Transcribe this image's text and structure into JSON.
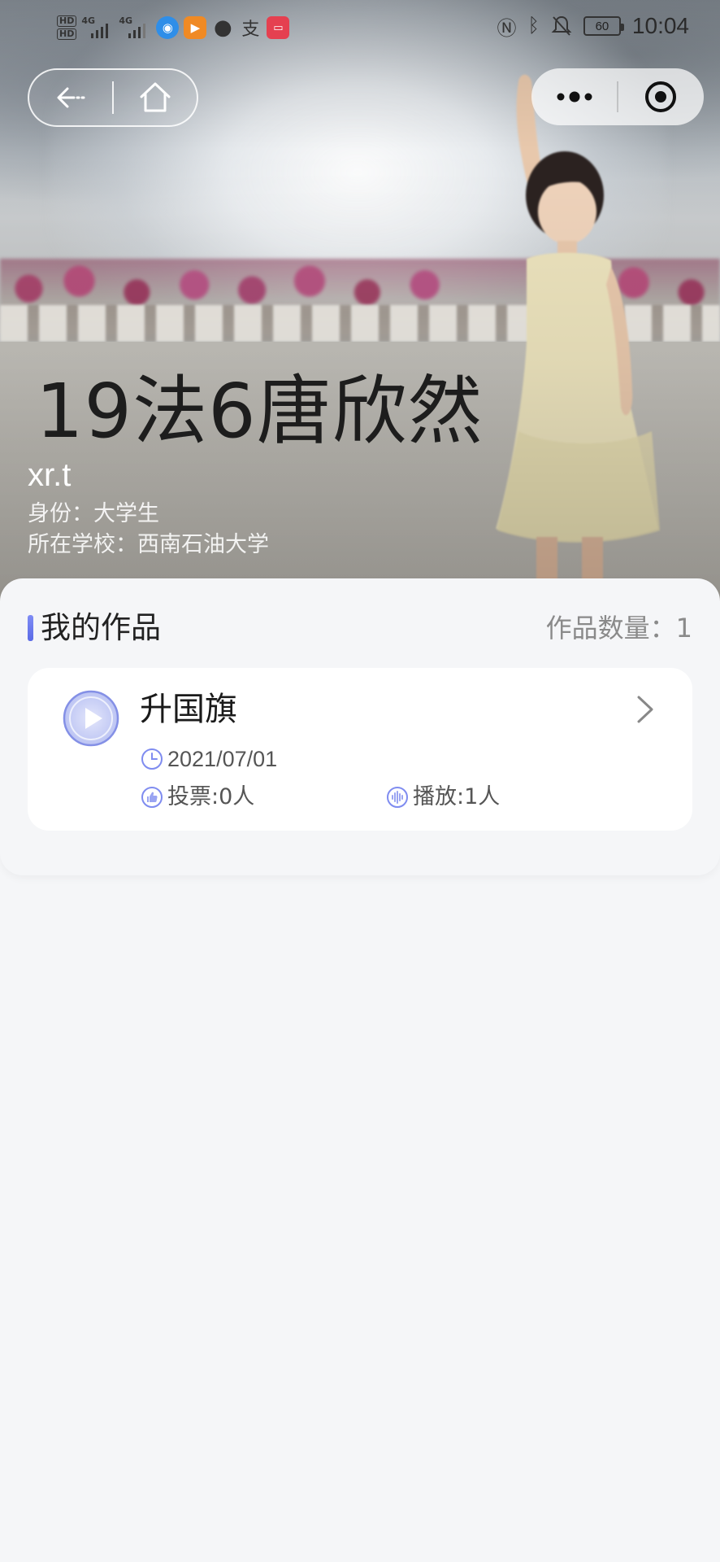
{
  "status_bar": {
    "time": "10:04",
    "battery": "60",
    "hd_top": "HD",
    "hd_bottom": "HD",
    "net1": "4G",
    "net2": "4G"
  },
  "capsule": {
    "back_icon": "back-arrow-icon",
    "home_icon": "home-icon",
    "more_icon": "more-dots-icon",
    "close_icon": "target-close-icon"
  },
  "profile": {
    "name": "19法6唐欣然",
    "nickname": "xr.t",
    "identity": "身份：大学生",
    "school": "所在学校：西南石油大学"
  },
  "works": {
    "section_title": "我的作品",
    "count_label": "作品数量：1",
    "items": [
      {
        "title": "升国旗",
        "date": "2021/07/01",
        "votes": "投票:0人",
        "plays": "播放:1人"
      }
    ]
  },
  "colors": {
    "accent": "#6b79ee",
    "page_bg": "#f5f6f8",
    "card_bg": "#ffffff"
  }
}
